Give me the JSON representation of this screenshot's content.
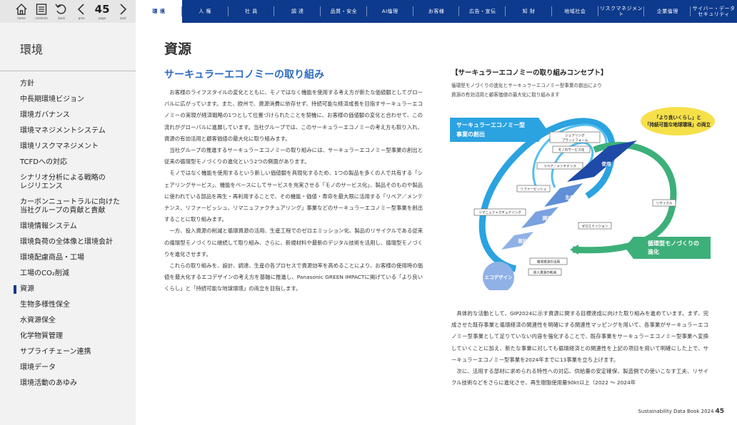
{
  "toolbar": {
    "home_label": "home",
    "contents_label": "contents",
    "back_label": "back",
    "prev_label": "prev",
    "page_label": "page",
    "next_label": "next",
    "page_number": "45"
  },
  "nav_tabs": [
    "環 境",
    "人 権",
    "社 員",
    "調 達",
    "品質・安全",
    "AI倫理",
    "お客様",
    "広告・宣伝",
    "知 財",
    "地域社会",
    "リスクマネジメント",
    "企業倫理",
    "サイバー・データ\nセキュリティ"
  ],
  "sidebar": {
    "title": "環境",
    "items": [
      "方針",
      "中長期環境ビジョン",
      "環境ガバナンス",
      "環境マネジメントシステム",
      "環境リスクマネジメント",
      "TCFDへの対応",
      "シナリオ分析による戦略の\nレジリエンス",
      "カーボンニュートラルに向けた\n当社グループの貢献と責献",
      "環境情報システム",
      "環境負荷の全体像と環境会計",
      "環境配慮商品・工場",
      "工場のCO₂削減",
      "資源",
      "生物多様性保全",
      "水資源保全",
      "化学物質管理",
      "サプライチェーン連携",
      "環境データ",
      "環境活動のあゆみ"
    ],
    "active": "資源"
  },
  "main": {
    "page_title": "資源",
    "section_title": "サーキュラーエコノミーの取り組み",
    "paragraphs": [
      "お客様のライフスタイルの変化とともに、モノではなく機能を使用する考え方が新たな価値観としてグローバルに広がっています。また、欧州で、資源消費に依存せず、持続可能な経済成長を目指すサーキュラーエコノミーの実現が経済戦略の1つとして位置づけられたことを契機に、お客様の価値観の変化と合わせて、この流れがグローバルに進展しています。当社グループでは、このサーキュラーエコノミーの考え方も取り入れ、資源の有効活用と顧客価値の最大化に取り組みます。",
      "当社グループの推進するサーキュラーエコノミーの取り組みには、サーキュラーエコノミー型事業の創出と従来の循環型モノづくりの進化という2つの側面があります。",
      "モノではなく機能を使用するという新しい価値観を具現化するため、1つの製品を多くの人で共有する「シェアリングサービス」、機能をベースにしてサービスを充実させる「モノのサービス化」、製品そのものや製品に使われている部品を再生・再利用することで、その機能・価値・寿命を最大限に活用する「リペア／メンテナンス、リファービッシュ、リマニュファクチュアリング」事業などのサーキュラーエコノミー型事業を創出することに取り組みます。",
      "一方、投入資源の削減と循環資源の活用、生産工程でのゼロエミッション化、製品のリサイクルである従来の循環型モノづくりに継続して取り組み、さらに、新規材料や最新のデジタル技術を活用し、循環型モノづくりを進化させます。",
      "これらの取り組みを、設計、調達、生産の各プロセスで資源効率を高めることにより、お客様の使用時の価値を最大化するエコデザインの考え方を基軸に推進し、Panasonic GREEN IMPACTに掲げている「より良いくらし」と「持続可能な地球環境」の両立を目指します。"
    ],
    "paragraphs_right": [
      "具体的な活動として、GIP2024に示す資源に関する目標達成に向けた取り組みを進めています。まず、完成させた既存事業と循環経済の関連性を明確にする関連性マッピングを用いて、各事業がサーキュラーエコノミー型事業として足りていない内容を強化することで、既存事業をサーキュラーエコノミー型事業へ変換していくことに加え、新たな事業に対しても循環経済との関連性を上記の項目を用いて明確にした上で、サーキュラーエコノミー型事業を2024年までに13事業を立ち上げます。",
      "次に、活用する部材に求められる特性への対応、供給量の安定確保、製造側での使いこなす工夫、リサイクル技術などをさらに進化させ、再生樹脂使用量90kt以上（2022 ～ 2024年"
    ]
  },
  "concept": {
    "title": "【サーキュラーエコノミーの取り組みコンセプト】",
    "subtitle": "循環型モノづくりの進化とサーキュラーエコノミー型事業の創出により\n資源の有効活用と顧客価値の最大化に取り組みます",
    "label_ce": "サーキュラーエコノミー型\n事業の創出",
    "label_both": "「より良いくらし」と\n「持続可能な地球環境」の両立",
    "label_mfg": "循環型モノづくりの\n進化",
    "steps": [
      "エコデザイン",
      "設計",
      "調達",
      "生産",
      "使用"
    ],
    "tags": [
      "シェアリング\nプラットフォーム",
      "モノのサービス化",
      "リペア／メンテナンス",
      "リファービッシュ",
      "リマニュファクチュアリング",
      "リサイクル",
      "ゼロエミッション",
      "循環資源の活用",
      "投入資源の削減"
    ],
    "colors": {
      "ce": "#2ba3e0",
      "mfg": "#3db07a",
      "step_light": "#8fb1e6",
      "step_dark": "#1f4aa8",
      "both_bg": "#f6e04a"
    }
  },
  "footer": {
    "text": "Sustainability Data Book 2024",
    "page": "45"
  }
}
